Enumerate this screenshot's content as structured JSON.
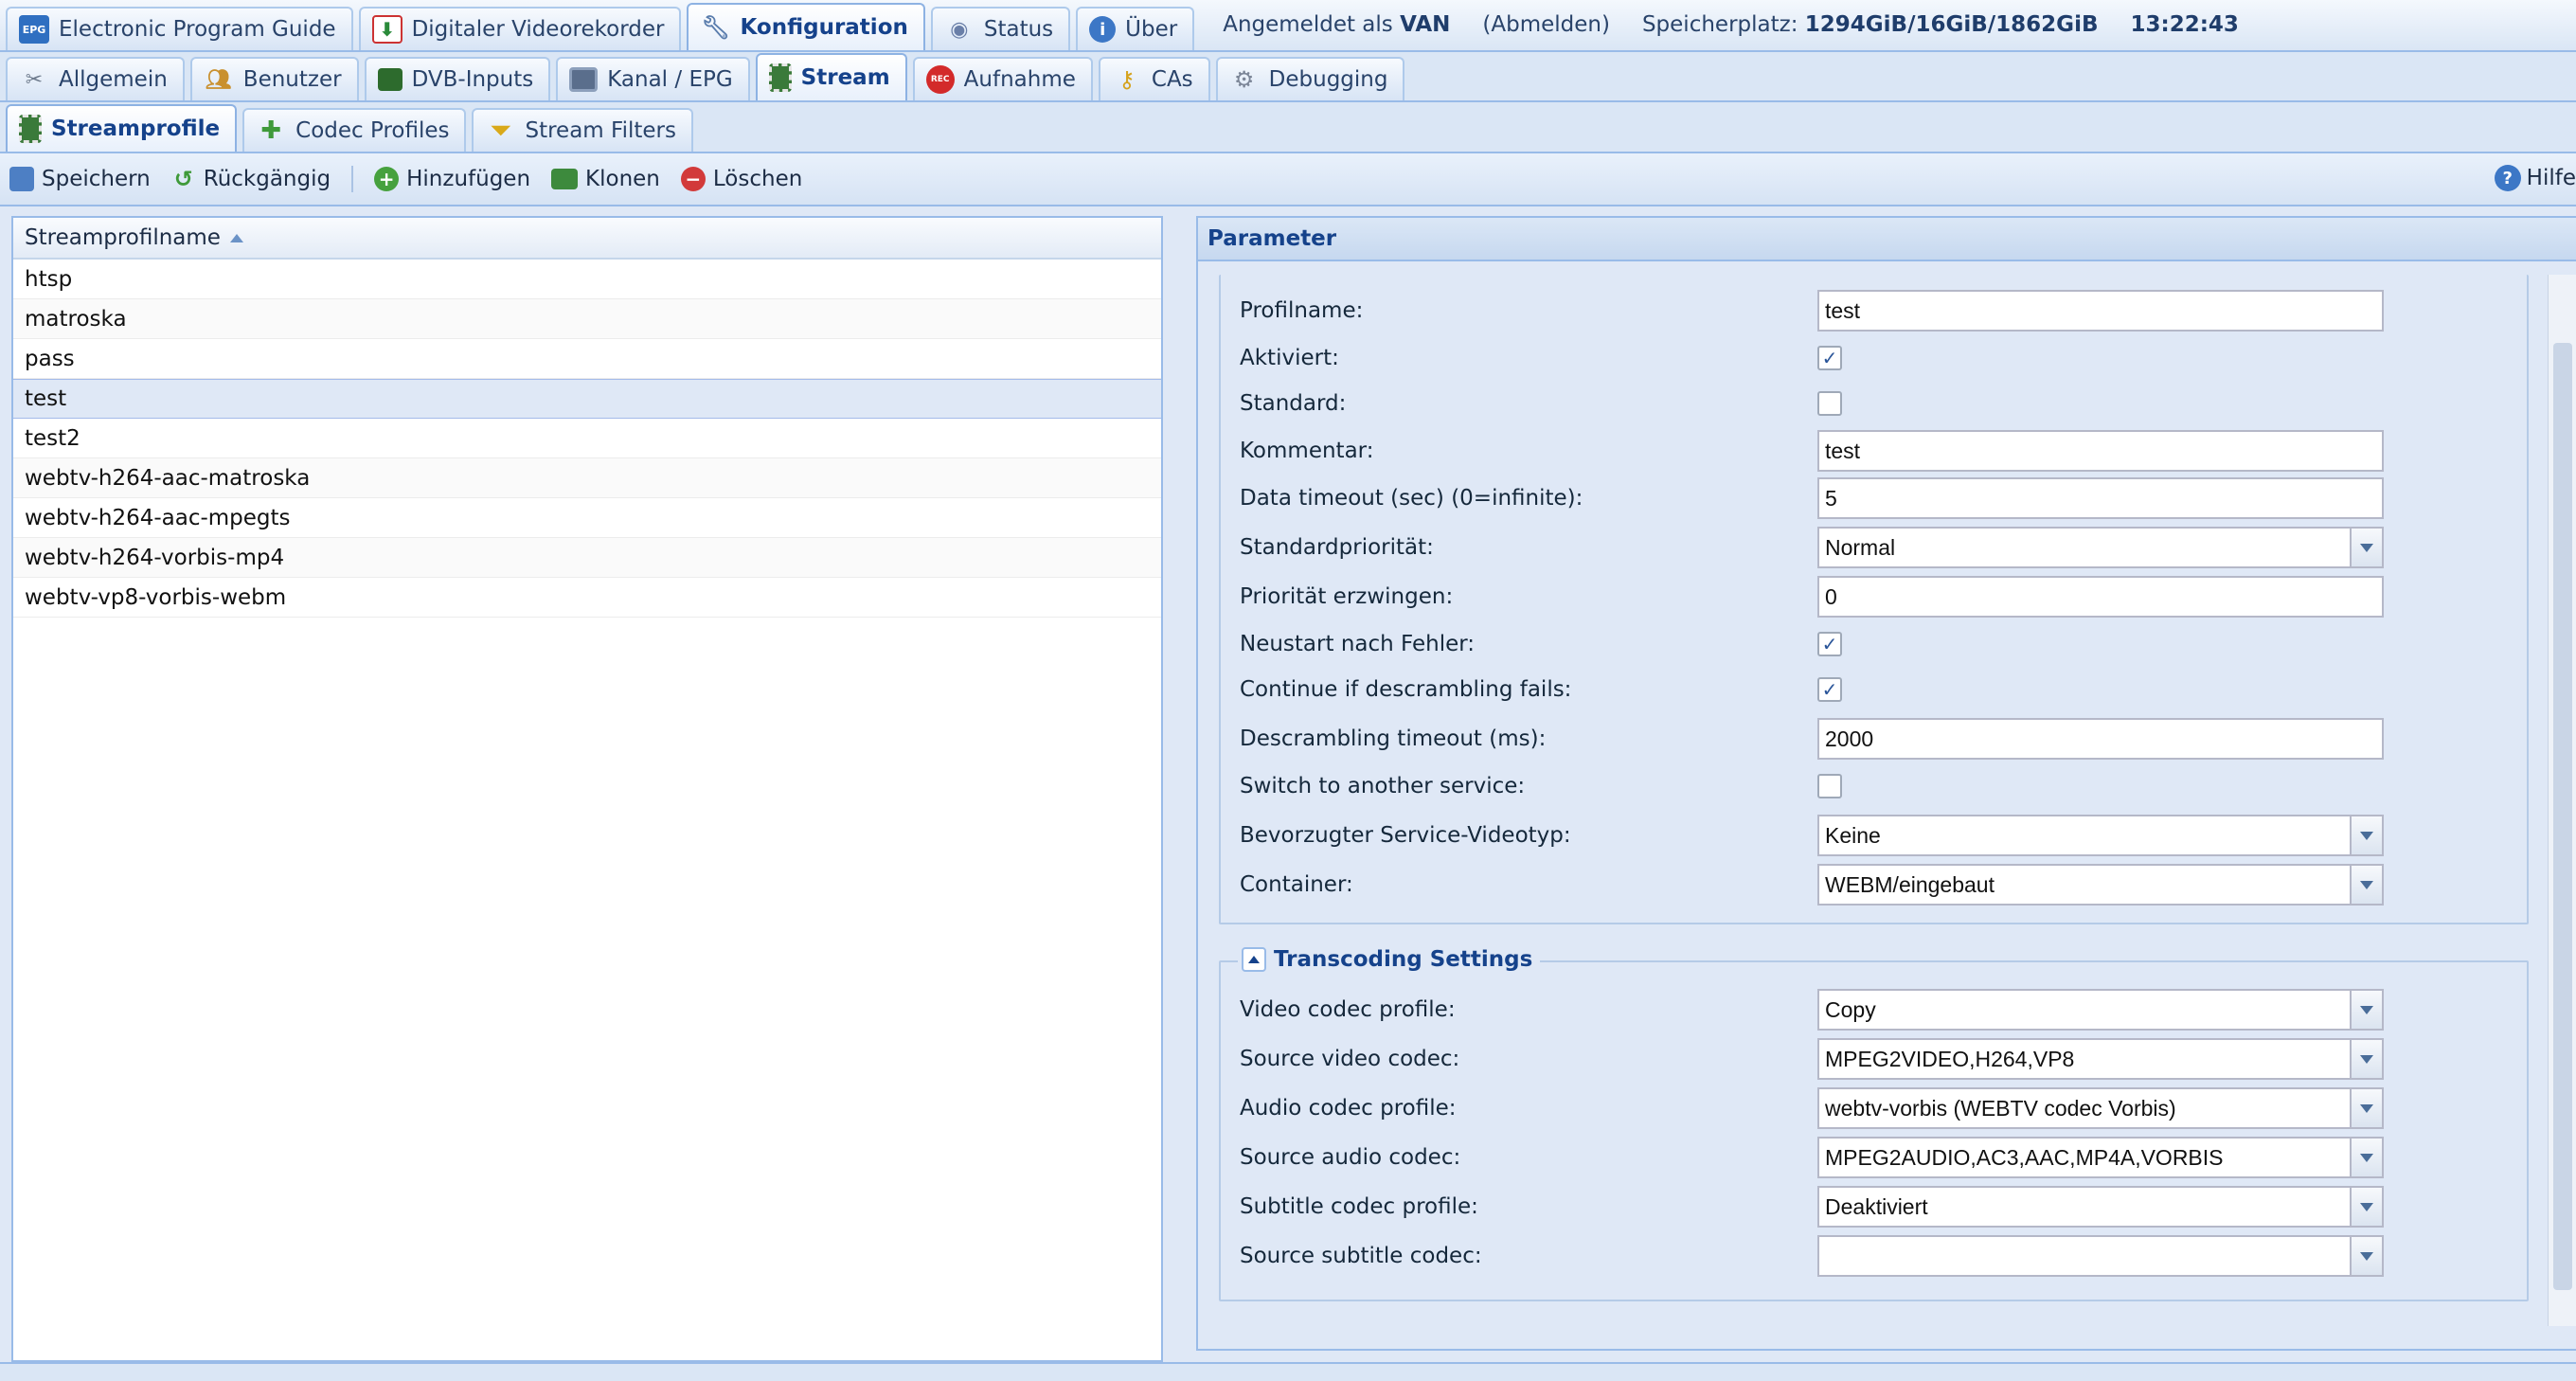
{
  "main_tabs": [
    {
      "label": "Electronic Program Guide",
      "icon": "epg-icon",
      "active": false
    },
    {
      "label": "Digitaler Videorekorder",
      "icon": "download-icon",
      "active": false
    },
    {
      "label": "Konfiguration",
      "icon": "wrench-icon",
      "active": true
    },
    {
      "label": "Status",
      "icon": "eye-icon",
      "active": false
    },
    {
      "label": "Über",
      "icon": "info-icon",
      "active": false
    }
  ],
  "session": {
    "logged_in_prefix": "Angemeldet als",
    "user": "VAN",
    "logout": "(Abmelden)",
    "storage_label": "Speicherplatz:",
    "storage_value": "1294GiB/16GiB/1862GiB",
    "time": "13:22:43"
  },
  "config_tabs": [
    {
      "label": "Allgemein",
      "icon": "tools-icon",
      "active": false
    },
    {
      "label": "Benutzer",
      "icon": "users-icon",
      "active": false
    },
    {
      "label": "DVB-Inputs",
      "icon": "card-icon",
      "active": false
    },
    {
      "label": "Kanal / EPG",
      "icon": "tv-icon",
      "active": false
    },
    {
      "label": "Stream",
      "icon": "film-icon",
      "active": true
    },
    {
      "label": "Aufnahme",
      "icon": "rec-icon",
      "active": false
    },
    {
      "label": "CAs",
      "icon": "key-icon",
      "active": false
    },
    {
      "label": "Debugging",
      "icon": "gears-icon",
      "active": false
    }
  ],
  "stream_tabs": [
    {
      "label": "Streamprofile",
      "icon": "film-icon",
      "active": true
    },
    {
      "label": "Codec Profiles",
      "icon": "puzzle-icon",
      "active": false
    },
    {
      "label": "Stream Filters",
      "icon": "funnel-icon",
      "active": false
    }
  ],
  "toolbar": {
    "save": "Speichern",
    "undo": "Rückgängig",
    "add": "Hinzufügen",
    "clone": "Klonen",
    "delete": "Löschen",
    "help": "Hilfe"
  },
  "grid": {
    "column": "Streamprofilname",
    "rows": [
      "htsp",
      "matroska",
      "pass",
      "test",
      "test2",
      "webtv-h264-aac-matroska",
      "webtv-h264-aac-mpegts",
      "webtv-h264-vorbis-mp4",
      "webtv-vp8-vorbis-webm"
    ],
    "selected": "test"
  },
  "panel": {
    "title": "Parameter",
    "fields": [
      {
        "label": "Profilname:",
        "type": "text",
        "value": "test"
      },
      {
        "label": "Aktiviert:",
        "type": "check",
        "checked": true
      },
      {
        "label": "Standard:",
        "type": "check",
        "checked": false
      },
      {
        "label": "Kommentar:",
        "type": "text",
        "value": "test"
      },
      {
        "label": "Data timeout (sec) (0=infinite):",
        "type": "text",
        "value": "5"
      },
      {
        "label": "Standardpriorität:",
        "type": "combo",
        "value": "Normal"
      },
      {
        "label": "Priorität erzwingen:",
        "type": "text",
        "value": "0"
      },
      {
        "label": "Neustart nach Fehler:",
        "type": "check",
        "checked": true
      },
      {
        "label": "Continue if descrambling fails:",
        "type": "check",
        "checked": true
      },
      {
        "label": "Descrambling timeout (ms):",
        "type": "text",
        "value": "2000"
      },
      {
        "label": "Switch to another service:",
        "type": "check",
        "checked": false
      },
      {
        "label": "Bevorzugter Service-Videotyp:",
        "type": "combo",
        "value": "Keine"
      },
      {
        "label": "Container:",
        "type": "combo",
        "value": "WEBM/eingebaut"
      }
    ],
    "transcoding": {
      "title": "Transcoding Settings",
      "fields": [
        {
          "label": "Video codec profile:",
          "type": "combo",
          "value": "Copy"
        },
        {
          "label": "Source video codec:",
          "type": "combo",
          "value": "MPEG2VIDEO,H264,VP8"
        },
        {
          "label": "Audio codec profile:",
          "type": "combo",
          "value": "webtv-vorbis (WEBTV codec Vorbis)"
        },
        {
          "label": "Source audio codec:",
          "type": "combo",
          "value": "MPEG2AUDIO,AC3,AAC,MP4A,VORBIS"
        },
        {
          "label": "Subtitle codec profile:",
          "type": "combo",
          "value": "Deaktiviert"
        },
        {
          "label": "Source subtitle codec:",
          "type": "combo",
          "value": ""
        }
      ]
    }
  },
  "colors": {
    "accent": "#15428b",
    "tab_border": "#99bbe8",
    "panel_bg": "#dfe8f6",
    "selected_row": "#dfe8f6"
  }
}
